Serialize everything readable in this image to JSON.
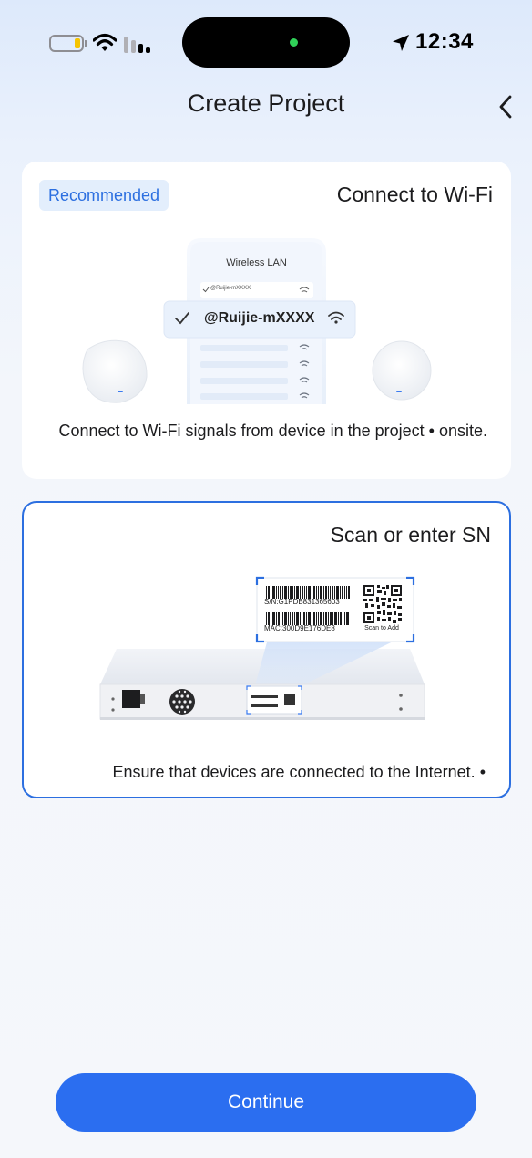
{
  "status_bar": {
    "time": "12:34",
    "battery_icon": "battery-low-icon",
    "wifi_icon": "wifi-icon",
    "cell_icon": "cellular-signal-icon",
    "location_icon": "location-arrow-icon",
    "battery_color": "#f5c400"
  },
  "nav": {
    "title": "Create Project",
    "back_icon": "chevron-left-icon"
  },
  "options": [
    {
      "badge": "Recommended",
      "title": "Connect to Wi-Fi",
      "description": "Connect to Wi-Fi signals from device in the project • onsite.",
      "selected": false,
      "illustration": {
        "phone_header": "Wireless LAN",
        "list_item_small": "@Ruijie-mXXXX",
        "highlight_ssid": "@Ruijie-mXXXX"
      }
    },
    {
      "title": "Scan or enter SN",
      "description": "Ensure that devices are connected to the Internet. •",
      "selected": true,
      "illustration": {
        "sn": "S/N:G1PDB831365603",
        "mac": "MAC:300D9E176DE8",
        "scan_caption": "Scan to Add"
      }
    }
  ],
  "continue_label": "Continue",
  "colors": {
    "accent": "#2b6ef0",
    "selected_border": "#2c6fe0",
    "badge_bg": "#e3eefc"
  }
}
